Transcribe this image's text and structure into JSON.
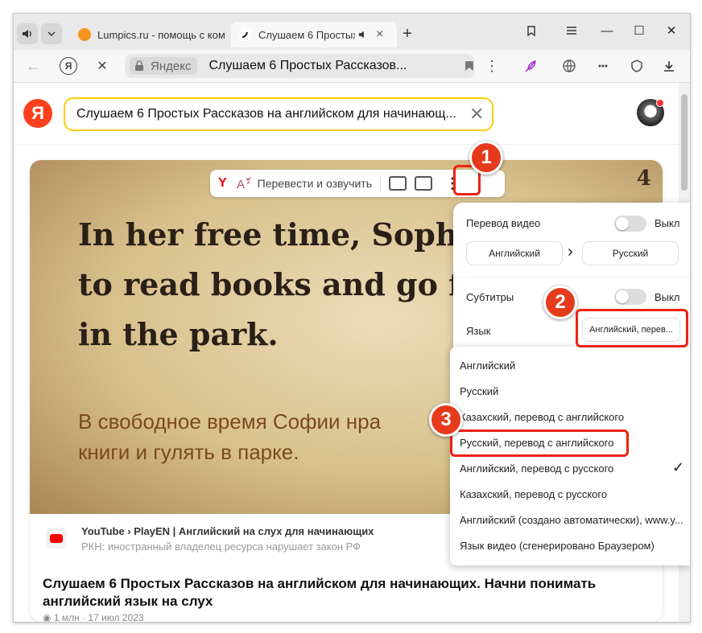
{
  "tabs": [
    {
      "title": "Lumpics.ru - помощь с ком",
      "favicon": "orange-favicon"
    },
    {
      "title": "Слушаем 6 Простых",
      "favicon": "video-favicon",
      "audio_icon": "speaker-icon",
      "close": "×"
    }
  ],
  "tabbar": {
    "new_tab": "+"
  },
  "window_controls": {
    "minimize": "—",
    "maximize": "☐",
    "close": "✕"
  },
  "address_bar": {
    "back": "←",
    "yandex_btn": "Я",
    "stop": "✕",
    "lock_chip": "Яндекс",
    "url_title": "Слушаем 6 Простых Рассказов...",
    "bookmark": "bookmark-icon",
    "menu": "⋮"
  },
  "page": {
    "logo": "Я",
    "search_query": "Слушаем 6 Простых Рассказов на английском для начинающ...",
    "search_clear": "✕"
  },
  "video": {
    "number": "4",
    "english_lines": [
      "In her free time, Soph",
      "to read books and go f",
      "in the park."
    ],
    "russian_lines": [
      "В свободное время Софии нра",
      "книги и гулять в парке."
    ],
    "toolbar": {
      "y": "Y",
      "translate_label": "Перевести и озвучить",
      "more": "⋮"
    }
  },
  "source": {
    "name": "YouTube › PlayEN | Английский на слух для начинающих",
    "warning": "РКН: иностранный владелец ресурса нарушает закон РФ"
  },
  "result": {
    "title": "Слушаем 6 Простых Рассказов на английском для начинающих. Начни понимать английский язык на слух",
    "meta": "1 млн · 17 июл 2023"
  },
  "panel": {
    "video_translation": "Перевод видео",
    "video_translation_state": "Выкл",
    "from_lang": "Английский",
    "arrow": "›",
    "to_lang": "Русский",
    "subtitles": "Субтитры",
    "subtitles_state": "Выкл",
    "language_label": "Язык",
    "language_value": "Английский, перев..."
  },
  "dropdown": {
    "options": [
      "Английский",
      "Русский",
      "Казахский, перевод с английского",
      "Русский, перевод с английского",
      "Английский, перевод с русского",
      "Казахский, перевод с русского",
      "Английский (создано автоматически), www.y...",
      "Язык видео (сгенерировано Браузером)"
    ],
    "checked_index": 4,
    "check": "✓"
  },
  "annotations": {
    "step1": "1",
    "step2": "2",
    "step3": "3",
    "color": "#e21e10"
  }
}
